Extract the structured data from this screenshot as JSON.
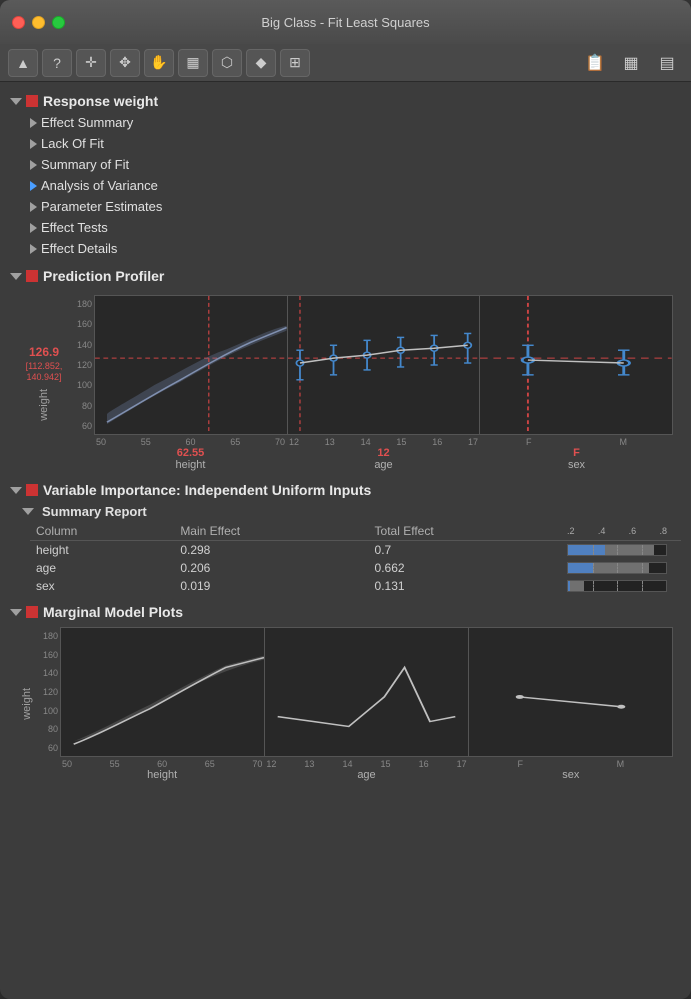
{
  "window": {
    "title": "Big Class - Fit Least Squares"
  },
  "toolbar": {
    "buttons": [
      {
        "name": "cursor",
        "icon": "▲"
      },
      {
        "name": "help",
        "icon": "?"
      },
      {
        "name": "crosshair",
        "icon": "✛"
      },
      {
        "name": "move",
        "icon": "✥"
      },
      {
        "name": "hand",
        "icon": "✋"
      },
      {
        "name": "brush",
        "icon": "▦"
      },
      {
        "name": "lasso",
        "icon": "⬡"
      },
      {
        "name": "probe",
        "icon": "◈"
      },
      {
        "name": "formula",
        "icon": "⊞"
      }
    ],
    "right_buttons": [
      {
        "name": "script",
        "icon": "📋"
      },
      {
        "name": "table",
        "icon": "▦"
      },
      {
        "name": "grid",
        "icon": "▤"
      }
    ]
  },
  "sections": [
    {
      "id": "response-weight",
      "label": "Response weight",
      "expanded": true,
      "has_red_square": true,
      "subsections": [
        {
          "id": "effect-summary",
          "label": "Effect Summary",
          "expanded": false
        },
        {
          "id": "lack-of-fit",
          "label": "Lack Of Fit",
          "expanded": false
        },
        {
          "id": "summary-of-fit",
          "label": "Summary of Fit",
          "expanded": false
        },
        {
          "id": "analysis-of-variance",
          "label": "Analysis of Variance",
          "expanded": true,
          "blue_arrow": true
        },
        {
          "id": "parameter-estimates",
          "label": "Parameter Estimates",
          "expanded": false
        },
        {
          "id": "effect-tests",
          "label": "Effect Tests",
          "expanded": false
        },
        {
          "id": "effect-details",
          "label": "Effect Details",
          "expanded": false
        }
      ]
    }
  ],
  "prediction_profiler": {
    "title": "Prediction Profiler",
    "has_red_square": true,
    "value": "126.9",
    "ci": "[112.852, 140.942]",
    "ylabel": "weight",
    "yaxis_labels": [
      "180",
      "160",
      "140",
      "120",
      "100",
      "80",
      "60"
    ],
    "horizontal_line": 126.9,
    "charts": [
      {
        "id": "height-chart",
        "xlabel": "62.55",
        "xname": "height",
        "xaxis_ticks": [
          "50",
          "55",
          "60",
          "65",
          "70"
        ]
      },
      {
        "id": "age-chart",
        "xlabel": "12",
        "xname": "age",
        "xaxis_ticks": [
          "12",
          "13",
          "14",
          "15",
          "16",
          "17"
        ]
      },
      {
        "id": "sex-chart",
        "xlabel": "F",
        "xname": "sex",
        "xaxis_ticks": [
          "F",
          "M"
        ]
      }
    ]
  },
  "variable_importance": {
    "title": "Variable Importance: Independent Uniform Inputs",
    "has_red_square": true,
    "summary_report": {
      "title": "Summary Report",
      "columns": [
        "Column",
        "Main Effect",
        "Total Effect",
        ".2  .4  .6  .8"
      ],
      "rows": [
        {
          "column": "height",
          "main_effect": "0.298",
          "total_effect": "0.7"
        },
        {
          "column": "age",
          "main_effect": "0.206",
          "total_effect": "0.662"
        },
        {
          "column": "sex",
          "main_effect": "0.019",
          "total_effect": "0.131"
        }
      ],
      "bar_axis": [
        ".2",
        ".4",
        ".6",
        ".8"
      ]
    }
  },
  "marginal_model_plots": {
    "title": "Marginal Model Plots",
    "has_red_square": true,
    "ylabel": "weight",
    "yaxis_labels": [
      "180",
      "160",
      "140",
      "120",
      "100",
      "80",
      "60"
    ],
    "charts": [
      {
        "id": "mmp-height",
        "xname": "height",
        "xaxis_ticks": [
          "50",
          "55",
          "60",
          "65",
          "70"
        ]
      },
      {
        "id": "mmp-age",
        "xname": "age",
        "xaxis_ticks": [
          "12",
          "13",
          "14",
          "15",
          "16",
          "17"
        ]
      },
      {
        "id": "mmp-sex",
        "xname": "sex",
        "xaxis_ticks": [
          "F",
          "M"
        ]
      }
    ]
  }
}
